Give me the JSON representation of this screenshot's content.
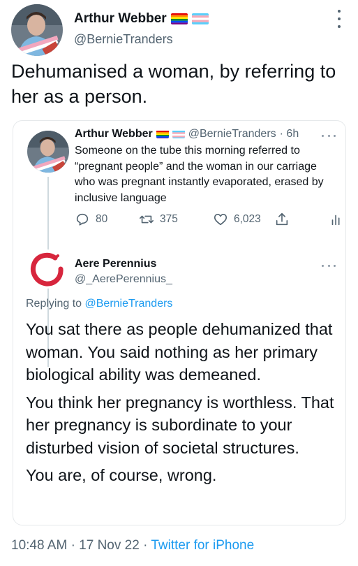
{
  "main_tweet": {
    "author_name": "Arthur Webber",
    "author_handle": "@BernieTranders",
    "text": "Dehumanised a woman, by referring to her as a person.",
    "flags": [
      "rainbow-flag-icon",
      "trans-flag-icon"
    ]
  },
  "quoted_tweet": {
    "author_name": "Arthur Webber",
    "author_handle": "@BernieTranders",
    "time": "· 6h",
    "text": "Someone on the tube this morning referred to “pregnant people” and the woman in our carriage who was pregnant instantly evaporated, erased by inclusive language",
    "replies": "80",
    "retweets": "375",
    "likes": "6,023"
  },
  "reply": {
    "author_name": "Aere Perennius",
    "author_handle": "@_AerePerennius_",
    "replying_prefix": "Replying to",
    "replying_to": "@BernieTranders",
    "paragraphs": [
      "You sat there as people dehumanized that woman. You said nothing as her primary biological ability was demeaned.",
      "You think her pregnancy is worthless. That her pregnancy is subordinate to your disturbed vision of societal structures.",
      "You are, of course, wrong."
    ]
  },
  "footer": {
    "time": "10:48 AM",
    "separator": "·",
    "date": "17 Nov 22",
    "source": "Twitter for iPhone"
  },
  "colors": {
    "text": "#0f1419",
    "secondary": "#536471",
    "link": "#1d9bf0",
    "border": "#e6e9eb"
  }
}
